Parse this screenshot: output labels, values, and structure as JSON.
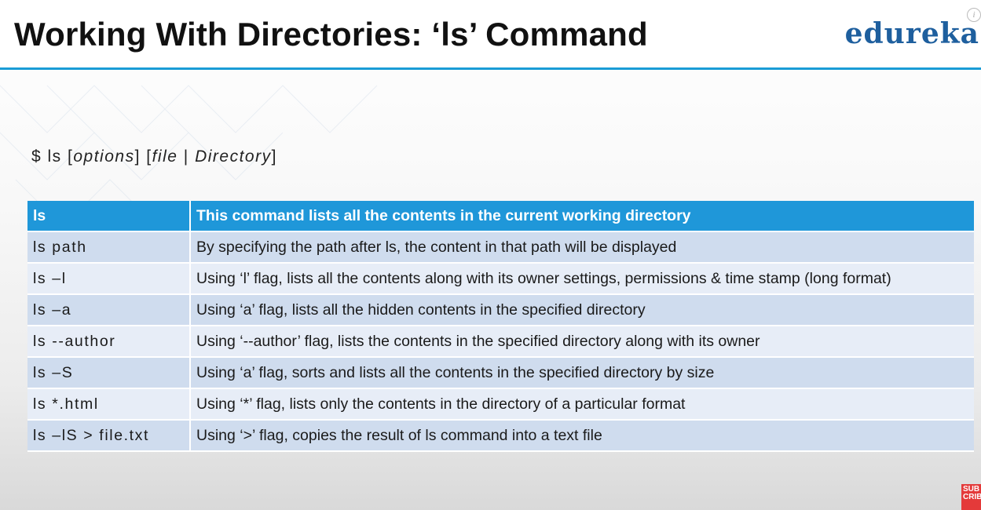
{
  "header": {
    "title": "Working With Directories: ‘ls’ Command",
    "brand": "edureka"
  },
  "syntax": {
    "prefix": "$ ls [",
    "options": "options",
    "mid": "] [",
    "file": "file",
    "sep": " | ",
    "directory": "Directory",
    "suffix": "]"
  },
  "table": {
    "header": [
      "ls",
      "This command lists all the contents in the current working directory"
    ],
    "rows": [
      [
        "ls path",
        "By specifying the path after ls, the content in that path will be displayed"
      ],
      [
        "ls –l",
        "Using ‘l’ flag, lists all the contents along with its owner settings, permissions & time stamp (long format)"
      ],
      [
        "ls –a",
        "Using ‘a’ flag, lists all the hidden contents in the specified directory"
      ],
      [
        "ls --author",
        "Using ‘--author’ flag, lists the contents in the specified directory along with its owner"
      ],
      [
        "ls –S",
        "Using ‘a’ flag, sorts and lists all the contents in the specified directory by size"
      ],
      [
        "ls *.html",
        "Using ‘*’ flag, lists only the contents in the directory of a particular format"
      ],
      [
        "ls –lS > file.txt",
        "Using ‘>’ flag, copies the result of ls command into a text file"
      ]
    ]
  },
  "badge": {
    "line1": "SUB",
    "line2": "CRIB"
  },
  "colors": {
    "accent": "#1f97d9",
    "brand": "#1e5f9e",
    "row_dark": "#cfdcee",
    "row_light": "#e7edf7"
  }
}
